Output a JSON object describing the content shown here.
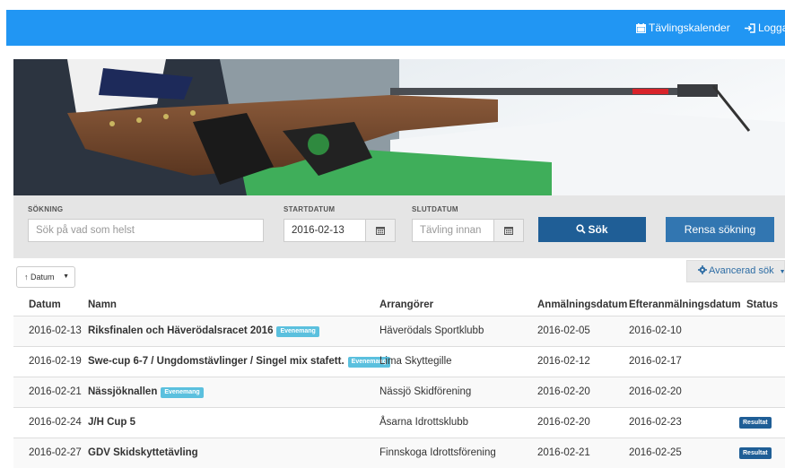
{
  "nav": {
    "calendar_label": "Tävlingskalender",
    "login_label": "Logga in"
  },
  "search": {
    "label_search": "SÖKNING",
    "search_placeholder": "Sök på vad som helst",
    "label_start": "STARTDATUM",
    "start_value": "2016-02-13",
    "label_end": "SLUTDATUM",
    "end_placeholder": "Tävling innan",
    "search_button": "Sök",
    "clear_button": "Rensa sökning"
  },
  "sort": {
    "selected": "↑ Datum"
  },
  "advanced": {
    "label": "Avancerad sök"
  },
  "table": {
    "headers": [
      "Datum",
      "Namn",
      "Arrangörer",
      "Anmälningsdatum",
      "Efteranmälningsdatum",
      "Status"
    ],
    "rows": [
      {
        "date": "2016-02-13",
        "name": "Riksfinalen och Häverödalsracet 2016",
        "tag": "Evenemang",
        "organizer": "Häverödals Sportklubb",
        "signup": "2016-02-05",
        "late_signup": "2016-02-10",
        "status": ""
      },
      {
        "date": "2016-02-19",
        "name": "Swe-cup 6-7 / Ungdomstävlinger / Singel mix stafett.",
        "tag": "Evenemang",
        "organizer": "Lima Skyttegille",
        "signup": "2016-02-12",
        "late_signup": "2016-02-17",
        "status": ""
      },
      {
        "date": "2016-02-21",
        "name": "Nässjöknallen",
        "tag": "Evenemang",
        "organizer": "Nässjö Skidförening",
        "signup": "2016-02-20",
        "late_signup": "2016-02-20",
        "status": ""
      },
      {
        "date": "2016-02-24",
        "name": "J/H Cup 5",
        "tag": "",
        "organizer": "Åsarna Idrottsklubb",
        "signup": "2016-02-20",
        "late_signup": "2016-02-23",
        "status": "Resultat"
      },
      {
        "date": "2016-02-27",
        "name": "GDV Skidskyttetävling",
        "tag": "",
        "organizer": "Finnskoga Idrottsförening",
        "signup": "2016-02-21",
        "late_signup": "2016-02-25",
        "status": "Resultat"
      }
    ]
  },
  "colors": {
    "primary": "#2196f3",
    "dark_button": "#1f5e96",
    "tag": "#5bc0de"
  }
}
